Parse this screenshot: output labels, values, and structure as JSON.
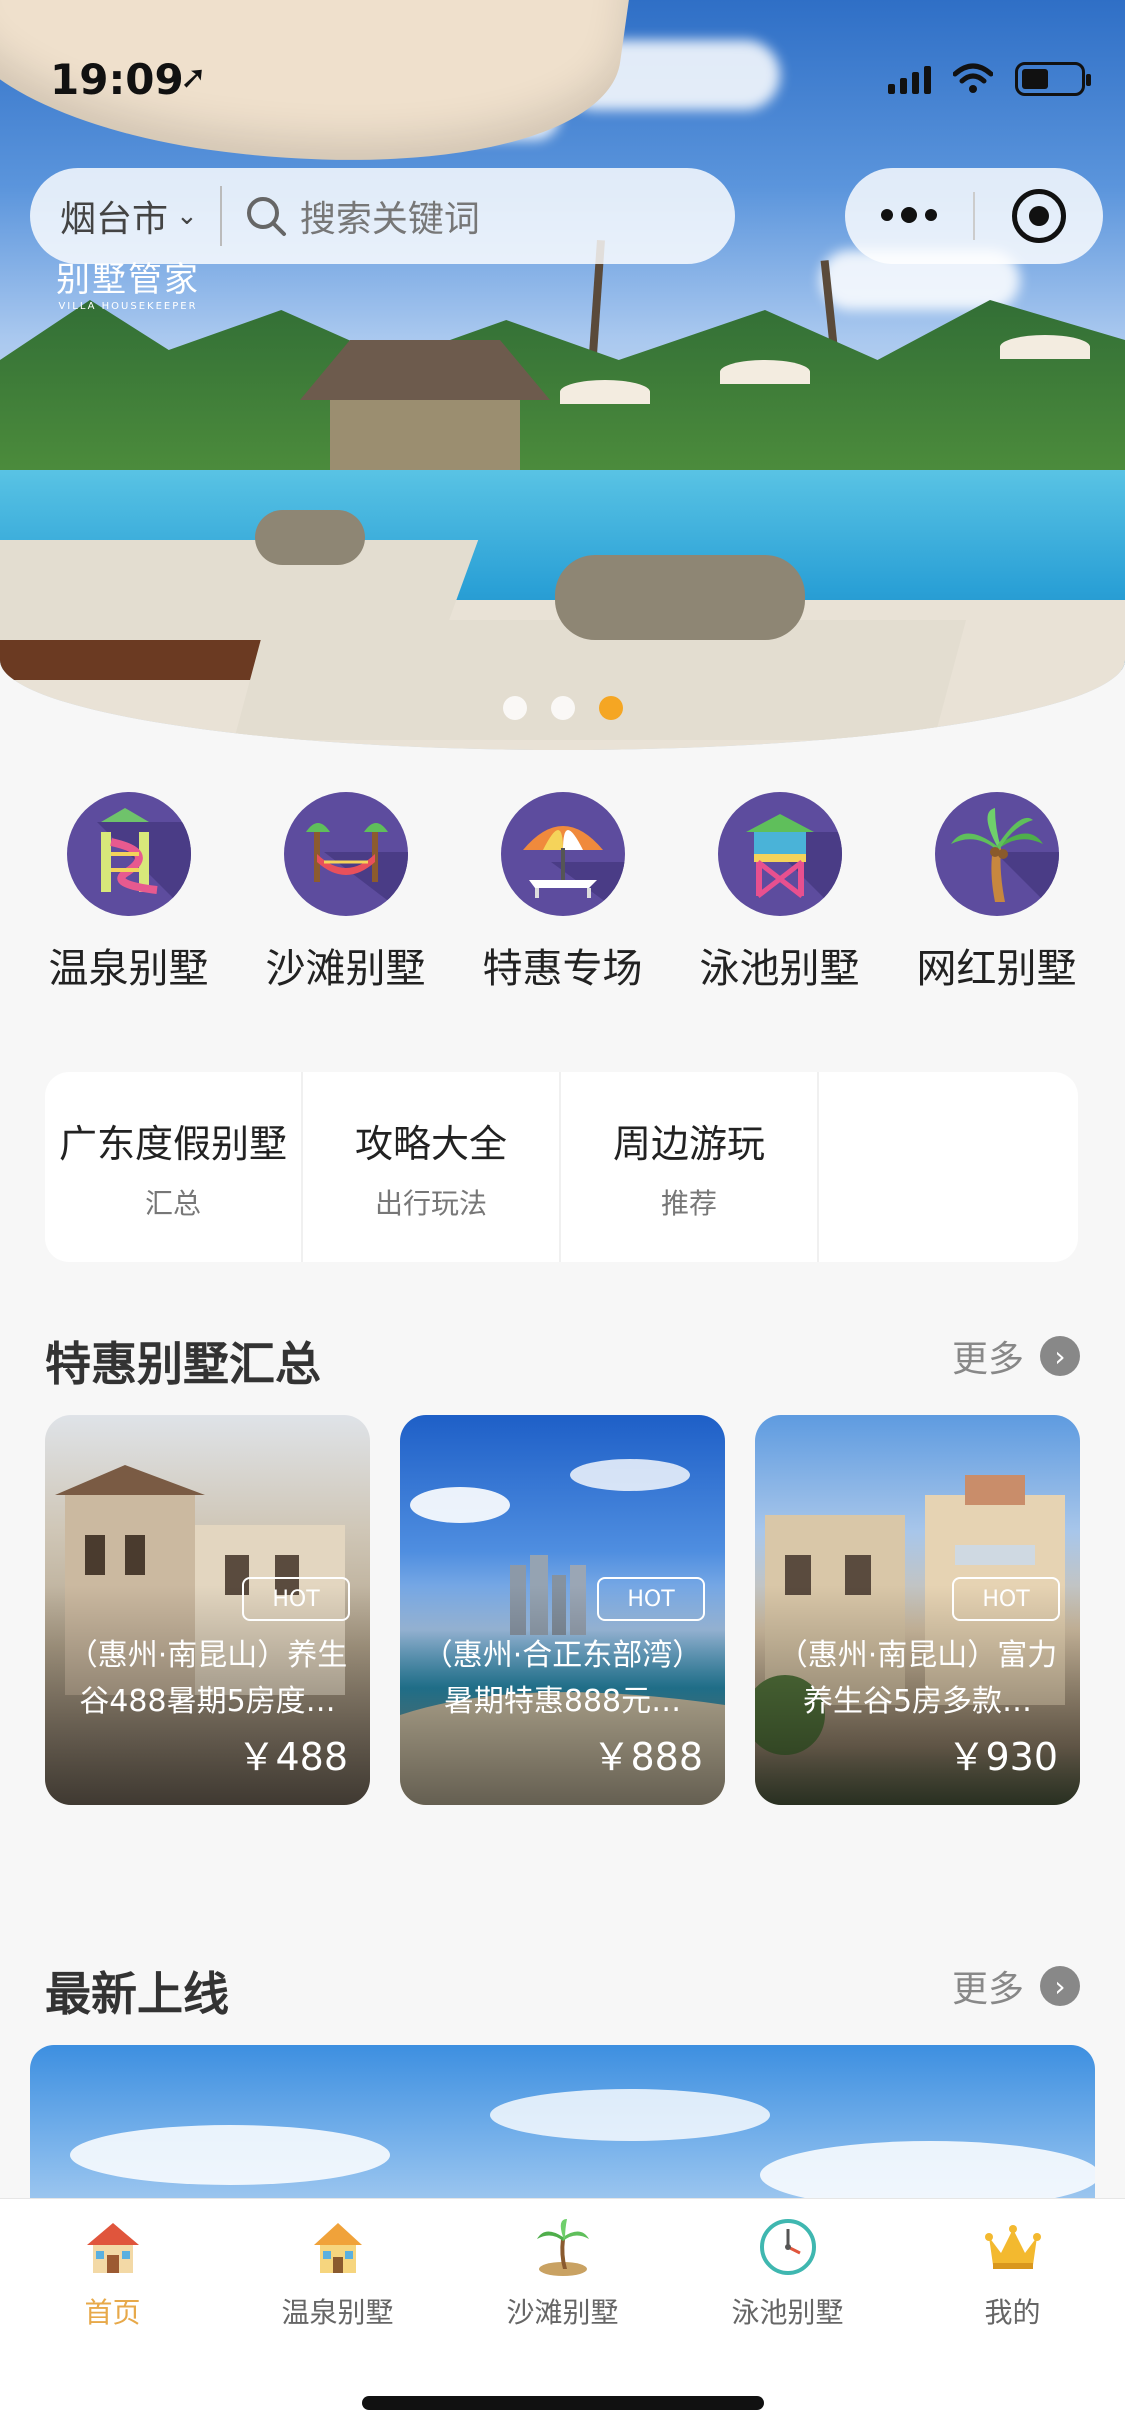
{
  "status_bar": {
    "time": "19:09"
  },
  "header": {
    "city": "烟台市",
    "search_placeholder": "搜索关键词",
    "logo_cn": "别墅管家",
    "logo_en": "VILLA HOUSEKEEPER"
  },
  "carousel": {
    "count": 3,
    "active_index": 2,
    "active_color": "#f5a623"
  },
  "categories": [
    {
      "label": "温泉别墅",
      "icon": "water-slide-icon"
    },
    {
      "label": "沙滩别墅",
      "icon": "hammock-icon"
    },
    {
      "label": "特惠专场",
      "icon": "beach-umbrella-icon"
    },
    {
      "label": "泳池别墅",
      "icon": "lifeguard-tower-icon"
    },
    {
      "label": "网红别墅",
      "icon": "palm-tree-icon"
    }
  ],
  "quick_links": [
    {
      "title": "广东度假别墅",
      "sub": "汇总"
    },
    {
      "title": "攻略大全",
      "sub": "出行玩法"
    },
    {
      "title": "周边游玩",
      "sub": "推荐"
    }
  ],
  "deals": {
    "title": "特惠别墅汇总",
    "more": "更多",
    "items": [
      {
        "badge": "HOT",
        "desc": "（惠州·南昆山）养生谷488暑期5房度…",
        "price": "￥488"
      },
      {
        "badge": "HOT",
        "desc": "（惠州·合正东部湾）暑期特惠888元…",
        "price": "￥888"
      },
      {
        "badge": "HOT",
        "desc": "（惠州·南昆山）富力养生谷5房多款…",
        "price": "￥930"
      }
    ]
  },
  "new_listings": {
    "title": "最新上线",
    "more": "更多"
  },
  "tabbar": {
    "items": [
      {
        "label": "首页",
        "icon": "home-house-icon",
        "active": true
      },
      {
        "label": "温泉别墅",
        "icon": "villa-house-icon",
        "active": false
      },
      {
        "label": "沙滩别墅",
        "icon": "palm-island-icon",
        "active": false
      },
      {
        "label": "泳池别墅",
        "icon": "clock-icon",
        "active": false
      },
      {
        "label": "我的",
        "icon": "crown-icon",
        "active": false
      }
    ],
    "active_color": "#e7a94a"
  }
}
